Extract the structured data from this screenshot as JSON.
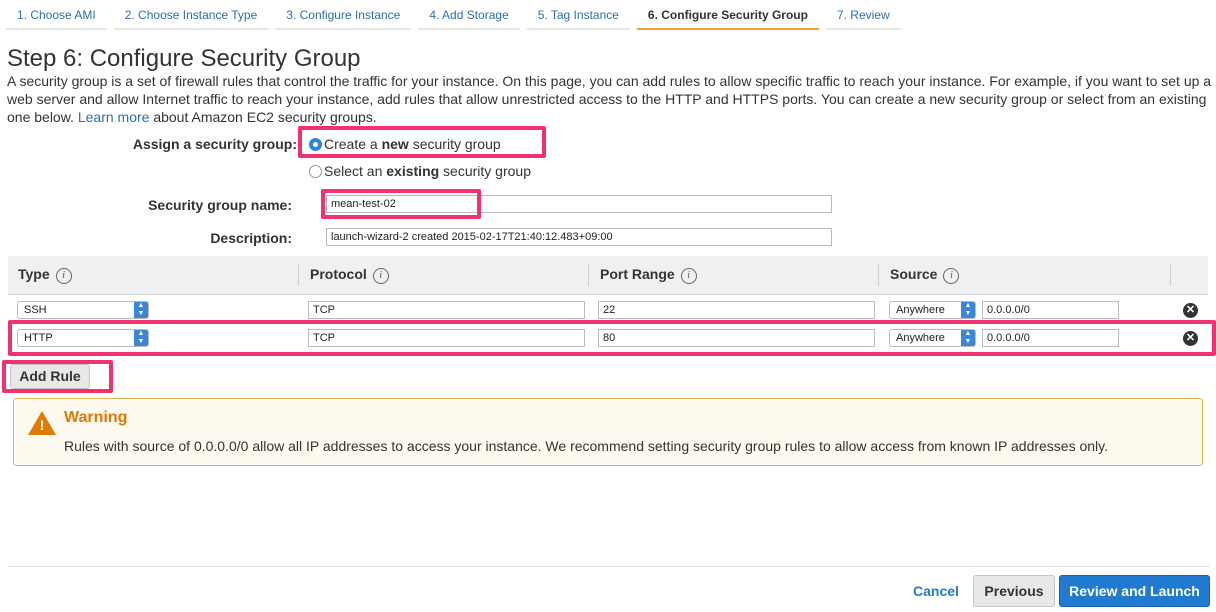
{
  "tabs": [
    {
      "label": "1. Choose AMI"
    },
    {
      "label": "2. Choose Instance Type"
    },
    {
      "label": "3. Configure Instance"
    },
    {
      "label": "4. Add Storage"
    },
    {
      "label": "5. Tag Instance"
    },
    {
      "label": "6. Configure Security Group"
    },
    {
      "label": "7. Review"
    }
  ],
  "page": {
    "title": "Step 6: Configure Security Group",
    "intro": "A security group is a set of firewall rules that control the traffic for your instance. On this page, you can add rules to allow specific traffic to reach your instance. For example, if you want to set up a web server and allow Internet traffic to reach your instance, add rules that allow unrestricted access to the HTTP and HTTPS ports. You can create a new security group or select from an existing one below.",
    "learn_more": "Learn more",
    "intro_tail": "about Amazon EC2 security groups."
  },
  "assign": {
    "label": "Assign a security group:",
    "option_new_pre": "Create a ",
    "option_new_bold": "new",
    "option_new_post": " security group",
    "option_existing_pre": "Select an ",
    "option_existing_bold": "existing",
    "option_existing_post": " security group",
    "selected": "new"
  },
  "form": {
    "name_label": "Security group name:",
    "name_value": "mean-test-02",
    "desc_label": "Description:",
    "desc_value": "launch-wizard-2 created 2015-02-17T21:40:12.483+09:00"
  },
  "table": {
    "headers": {
      "type": "Type",
      "protocol": "Protocol",
      "port_range": "Port Range",
      "source": "Source"
    },
    "info_glyph": "i",
    "rows": [
      {
        "type": "SSH",
        "protocol": "TCP",
        "port": "22",
        "source": "Anywhere",
        "cidr": "0.0.0.0/0"
      },
      {
        "type": "HTTP",
        "protocol": "TCP",
        "port": "80",
        "source": "Anywhere",
        "cidr": "0.0.0.0/0"
      }
    ]
  },
  "add_rule_label": "Add Rule",
  "warning": {
    "title": "Warning",
    "text": "Rules with source of 0.0.0.0/0 allow all IP addresses to access your instance. We recommend setting security group rules to allow access from known IP addresses only."
  },
  "footer": {
    "cancel": "Cancel",
    "previous": "Previous",
    "review": "Review and Launch"
  },
  "colors": {
    "accent": "#2b6fb3",
    "highlight": "#f0336f",
    "primary_button": "#1f7ad0",
    "warning": "#e07b00"
  }
}
